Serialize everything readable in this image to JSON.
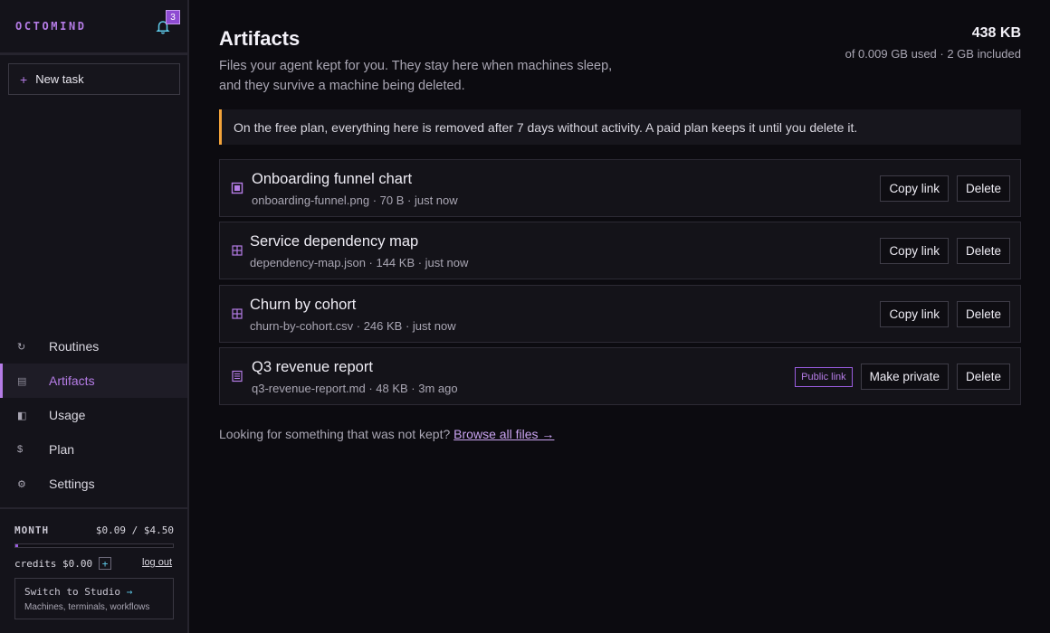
{
  "sidebar": {
    "brand": "OCTOMIND",
    "notifications_count": "3",
    "new_task_label": "New task",
    "nav": [
      {
        "label": "Routines",
        "icon": "refresh-icon"
      },
      {
        "label": "Artifacts",
        "icon": "archive-icon",
        "active": true
      },
      {
        "label": "Usage",
        "icon": "half-square-icon"
      },
      {
        "label": "Plan",
        "icon": "dollar-icon"
      },
      {
        "label": "Settings",
        "icon": "gear-icon"
      }
    ],
    "month_label": "MONTH",
    "month_value": "$0.09 / $4.50",
    "month_progress": 0.02,
    "credits": "credits $0.00",
    "credits_add": "+",
    "logout": "log out",
    "studio_title": "Switch to Studio",
    "studio_arrow": "→",
    "studio_sub": "Machines, terminals, workflows"
  },
  "main": {
    "title": "Artifacts",
    "description": "Files your agent kept for you. They stay here when machines sleep, and they survive a machine being deleted.",
    "usage_total": "438 KB",
    "usage_detail": "of 0.009 GB used · 2 GB included",
    "notice": "On the free plan, everything here is removed after 7 days without activity. A paid plan keeps it until you delete it.",
    "artifacts": [
      {
        "name": "Onboarding funnel chart",
        "meta": "onboarding-funnel.png · 70 B · just now",
        "icon": "image-icon",
        "copy_label": "Copy link",
        "delete_label": "Delete"
      },
      {
        "name": "Service dependency map",
        "meta": "dependency-map.json · 144 KB · just now",
        "icon": "grid-icon",
        "copy_label": "Copy link",
        "delete_label": "Delete"
      },
      {
        "name": "Churn by cohort",
        "meta": "churn-by-cohort.csv · 246 KB · just now",
        "icon": "grid-icon",
        "copy_label": "Copy link",
        "delete_label": "Delete"
      },
      {
        "name": "Q3 revenue report",
        "meta": "q3-revenue-report.md · 48 KB · 3m ago",
        "icon": "document-icon",
        "badge": "Public link",
        "private_label": "Make private",
        "delete_label": "Delete"
      }
    ],
    "footer_text": "Looking for something that was not kept?",
    "footer_link": "Browse all files →"
  },
  "colors": {
    "accent": "#b57ce6",
    "warning": "#f2a33a",
    "link_cyan": "#5ec9e8",
    "background": "#0c0b10"
  }
}
